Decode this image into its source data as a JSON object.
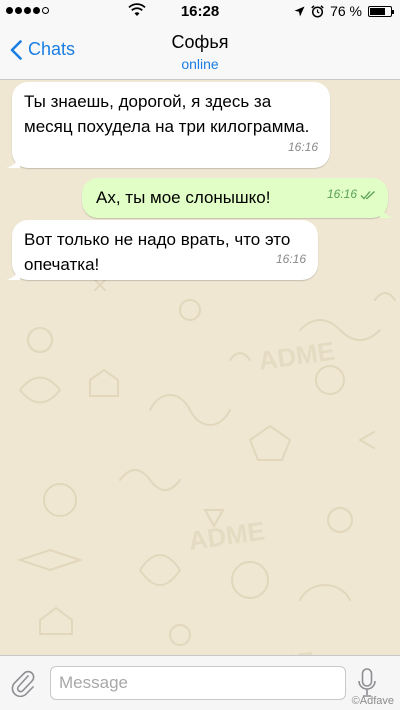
{
  "status_bar": {
    "time": "16:28",
    "battery_percent": "76 %",
    "battery_level": 0.76
  },
  "header": {
    "back_label": "Chats",
    "contact_name": "Софья",
    "contact_status": "online"
  },
  "messages": [
    {
      "direction": "in",
      "text": "Ты знаешь, дорогой, я здесь за месяц похудела на три килограмма.",
      "time": "16:16"
    },
    {
      "direction": "out",
      "text": "Ах, ты мое слонышко!",
      "time": "16:16",
      "read": true
    },
    {
      "direction": "in",
      "text": "Вот только не надо врать, что это опечатка!",
      "time": "16:16"
    }
  ],
  "input": {
    "placeholder": "Message"
  },
  "watermark": "©Adfave",
  "colors": {
    "accent": "#1a7ee2",
    "chat_background": "#efe7d2",
    "outgoing_bubble": "#e1fec6",
    "incoming_bubble": "#ffffff",
    "read_ticks": "#5aa25a"
  }
}
